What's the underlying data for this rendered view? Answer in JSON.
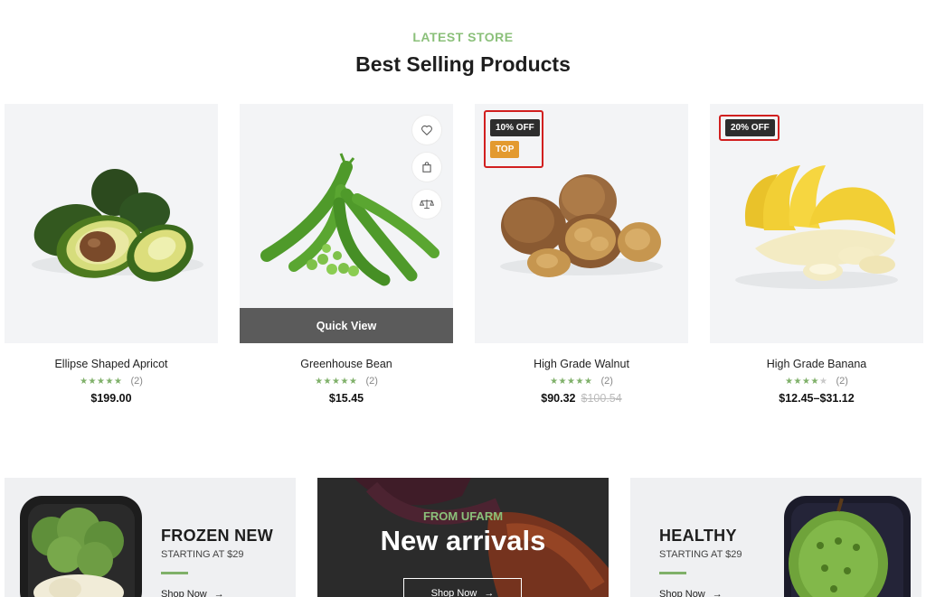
{
  "header": {
    "eyebrow": "LATEST STORE",
    "title": "Best Selling Products"
  },
  "products": [
    {
      "name": "Ellipse Shaped Apricot",
      "rating": 5,
      "stars": "★★★★★",
      "count": "(2)",
      "price": "$199.00",
      "old_price": ""
    },
    {
      "name": "Greenhouse Bean",
      "rating": 4.5,
      "stars": "★★★★★",
      "count": "(2)",
      "price": "$15.45",
      "old_price": "",
      "quick_view": "Quick View",
      "icons": [
        "heart-icon",
        "bag-icon",
        "compare-icon"
      ]
    },
    {
      "name": "High Grade Walnut",
      "rating": 4.5,
      "stars": "★★★★★",
      "count": "(2)",
      "price": "$90.32",
      "old_price": "$100.54",
      "badges": [
        "10% OFF",
        "TOP"
      ]
    },
    {
      "name": "High Grade Banana",
      "rating": 4,
      "stars_on": "★★★★",
      "stars_off": "★",
      "count": "(2)",
      "price": "$12.45–$31.12",
      "old_price": "",
      "badges": [
        "20% OFF"
      ]
    }
  ],
  "banners": [
    {
      "title": "FROZEN NEW",
      "sub": "STARTING AT $29",
      "link": "Shop Now",
      "arrow": "→"
    },
    {
      "eyebrow": "FROM UFARM",
      "title": "New arrivals",
      "link": "Shop Now",
      "arrow": "→"
    },
    {
      "title": "HEALTHY",
      "sub": "STARTING AT $29",
      "link": "Shop Now",
      "arrow": "→"
    }
  ],
  "colors": {
    "accent_green": "#8bc07a",
    "star_green": "#7fb069",
    "quick_view_bg": "#5b5b5b",
    "badge_dark": "#2d2d2d",
    "badge_top": "#e39a2f",
    "highlight_red": "#d11f1f"
  }
}
